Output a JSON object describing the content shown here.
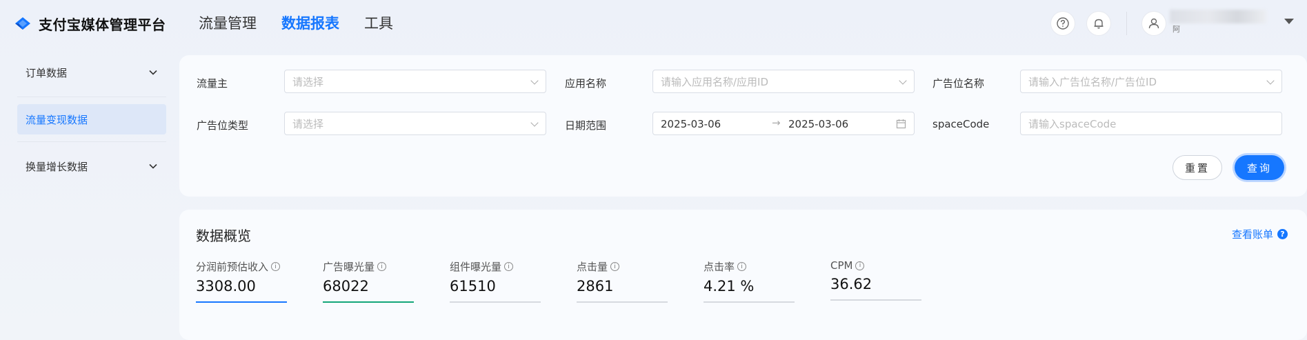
{
  "header": {
    "brand": "支付宝媒体管理平台",
    "nav": [
      "流量管理",
      "数据报表",
      "工具"
    ],
    "active_nav": "数据报表",
    "user_sub": "阿"
  },
  "sidebar": {
    "items": [
      {
        "label": "订单数据",
        "expandable": true
      },
      {
        "label": "流量变现数据",
        "active": true
      },
      {
        "label": "换量增长数据",
        "expandable": true
      }
    ]
  },
  "filters": {
    "traffic_owner": {
      "label": "流量主",
      "placeholder": "请选择"
    },
    "app_name": {
      "label": "应用名称",
      "placeholder": "请输入应用名称/应用ID"
    },
    "ad_slot_name": {
      "label": "广告位名称",
      "placeholder": "请输入广告位名称/广告位ID"
    },
    "ad_slot_type": {
      "label": "广告位类型",
      "placeholder": "请选择"
    },
    "date_range": {
      "label": "日期范围",
      "start": "2025-03-06",
      "end": "2025-03-06",
      "separator": "→"
    },
    "space_code": {
      "label": "spaceCode",
      "placeholder": "请输入spaceCode"
    },
    "reset_label": "重置",
    "query_label": "查询"
  },
  "overview": {
    "title": "数据概览",
    "link_label": "查看账单",
    "metrics": [
      {
        "label": "分润前预估收入",
        "value": "3308.00",
        "bar_color": "#1677ff"
      },
      {
        "label": "广告曝光量",
        "value": "68022",
        "bar_color": "#13a679"
      },
      {
        "label": "组件曝光量",
        "value": "61510",
        "bar_color": "#d6d9df"
      },
      {
        "label": "点击量",
        "value": "2861",
        "bar_color": "#d6d9df"
      },
      {
        "label": "点击率",
        "value": "4.21 %",
        "bar_color": "#d6d9df"
      },
      {
        "label": "CPM",
        "value": "36.62",
        "bar_color": "#d6d9df"
      }
    ]
  }
}
